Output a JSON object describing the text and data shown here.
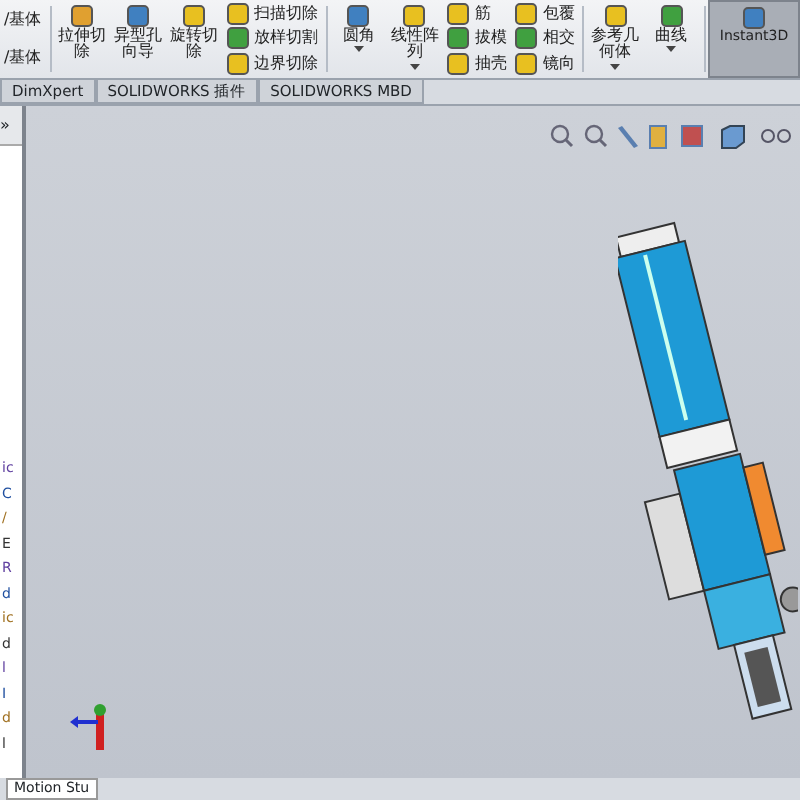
{
  "ribbon": {
    "items": [
      {
        "kind": "stack",
        "entries": [
          "/基体",
          "/基体"
        ]
      },
      {
        "kind": "separator"
      },
      {
        "kind": "large",
        "label": "拉伸切除"
      },
      {
        "kind": "large",
        "label": "异型孔向导"
      },
      {
        "kind": "large",
        "label": "旋转切除"
      },
      {
        "kind": "stack",
        "entries": [
          "扫描切除",
          "放样切割",
          "边界切除"
        ]
      },
      {
        "kind": "separator"
      },
      {
        "kind": "large",
        "label": "圆角",
        "has_menu": true
      },
      {
        "kind": "large",
        "label": "线性阵列",
        "has_menu": true
      },
      {
        "kind": "stack",
        "entries": [
          "筋",
          "拔模",
          "抽壳"
        ]
      },
      {
        "kind": "stack",
        "entries": [
          "包覆",
          "相交",
          "镜向"
        ]
      },
      {
        "kind": "separator"
      },
      {
        "kind": "large",
        "label": "参考几何体",
        "has_menu": true
      },
      {
        "kind": "large",
        "label": "曲线",
        "has_menu": true
      },
      {
        "kind": "separator"
      },
      {
        "kind": "large",
        "label": "Instant3D",
        "selected": true
      }
    ]
  },
  "tabs": [
    {
      "label": "DimXpert",
      "selected": false
    },
    {
      "label": "SOLIDWORKS 插件",
      "selected": false
    },
    {
      "label": "SOLIDWORKS MBD",
      "selected": false
    }
  ],
  "panel": {
    "expand": "»",
    "fragments": [
      "ic",
      "C",
      "/",
      "E",
      "R",
      "d",
      "ic",
      "d",
      "l",
      "I",
      "d",
      "l"
    ]
  },
  "bottom_tab": "Motion Stu"
}
